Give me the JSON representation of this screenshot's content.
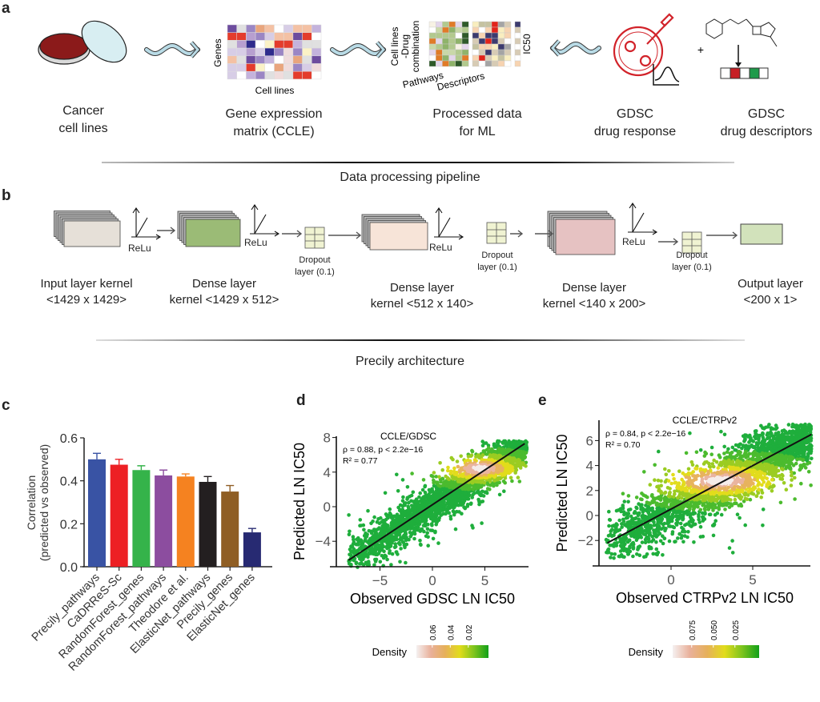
{
  "panels": {
    "a": "a",
    "b": "b",
    "c": "c",
    "d": "d",
    "e": "e"
  },
  "pipeline": {
    "cancer_cells": [
      "Cancer",
      "cell lines"
    ],
    "gene_matrix": [
      "Gene expression",
      "matrix (CCLE)"
    ],
    "gene_matrix_axes": {
      "y": "Genes",
      "x": "Cell lines"
    },
    "processed": [
      "Processed data",
      "for ML"
    ],
    "processed_axes": {
      "y1": "Cell lines",
      "y2": "-Drug",
      "y3": "combination",
      "x1": "Pathways",
      "x2": "Descriptors",
      "ic50": "IC50"
    },
    "drug_response": [
      "GDSC",
      "drug response"
    ],
    "plus": "+",
    "drug_descriptors": [
      "GDSC",
      "drug descriptors"
    ],
    "title": "Data processing pipeline",
    "colors": {
      "arrow": "#b9dbe6",
      "dish": "#8b1a1a",
      "response_icon": "#d2232a",
      "desc_red": "#c62026",
      "desc_green": "#1f9a4a"
    }
  },
  "architecture": {
    "relu": "ReLu",
    "layers": [
      {
        "name": "Input layer kernel",
        "size": "<1429 x 1429>",
        "color": "#e6e0d8"
      },
      {
        "name": "Dense layer",
        "size": "kernel <1429 x 512>",
        "color": "#9bbb76"
      },
      {
        "name": "Dense layer",
        "size": "kernel <512 x 140>",
        "color": "#f7e4d8"
      },
      {
        "name": "Dense layer",
        "size": "kernel <140 x 200>",
        "color": "#e6c2c2"
      },
      {
        "name": "Output layer",
        "size": "<200 x 1>",
        "color": "#d2e2bb"
      }
    ],
    "dropout": [
      "Dropout",
      "layer (0.1)"
    ],
    "dropout_color": "#f0f3d2",
    "title": "Precily architecture"
  },
  "chart_data": [
    {
      "type": "bar",
      "ylabel": [
        "Correlation",
        "(predicted vs observed)"
      ],
      "categories": [
        "Precily_pathways",
        "CaDRReS-Sc",
        "RandomForest_genes",
        "RandomForest_pathways",
        "Theodore et al.",
        "ElasticNet_pathways",
        "Precily_genes",
        "ElasticNet_genes"
      ],
      "values": [
        0.5,
        0.475,
        0.45,
        0.425,
        0.42,
        0.395,
        0.35,
        0.16
      ],
      "errors": [
        0.028,
        0.025,
        0.02,
        0.025,
        0.012,
        0.025,
        0.028,
        0.018
      ],
      "colors": [
        "#3953a4",
        "#ed2024",
        "#35b34a",
        "#8c4d9f",
        "#f58220",
        "#231f20",
        "#8f5e24",
        "#272a72"
      ],
      "ylim": [
        0,
        0.6
      ],
      "yticks": [
        "0.0",
        "0.2",
        "0.4",
        "0.6"
      ]
    },
    {
      "type": "scatter",
      "title": "CCLE/GDSC",
      "xlabel": "Observed GDSC LN IC50",
      "ylabel": "Predicted LN IC50",
      "xlim": [
        -9,
        9
      ],
      "ylim": [
        -7,
        8
      ],
      "xticks": [
        "−5",
        "0",
        "5"
      ],
      "xtick_values": [
        -5,
        0,
        5
      ],
      "yticks": [
        "−4",
        "0",
        "4",
        "8"
      ],
      "ytick_values": [
        -4,
        0,
        4,
        8
      ],
      "annotation": [
        "ρ = 0.88, p < 2.2e−16",
        "R² = 0.77"
      ],
      "fit_line": {
        "x": [
          -8,
          8.8
        ],
        "y": [
          -6.2,
          7.3
        ]
      },
      "cloud": {
        "x_range": [
          -8,
          9
        ],
        "slope": 0.8,
        "intercept": 0.2,
        "dense_center": [
          4.5,
          4.4
        ]
      },
      "colorbar": {
        "label": "Density",
        "ticks": [
          "0.06",
          "0.04",
          "0.02"
        ],
        "colors": [
          "#f5f0f0",
          "#e9b09a",
          "#e6b05a",
          "#e2dc1c",
          "#7ec41e",
          "#12a019"
        ]
      }
    },
    {
      "type": "scatter",
      "title": "CCLE/CTRPv2",
      "xlabel": "Observed CTRPv2 LN IC50",
      "ylabel": "Predicted LN IC50",
      "xlim": [
        -4.5,
        8.8
      ],
      "ylim": [
        -3.5,
        7.5
      ],
      "xticks": [
        "0",
        "5"
      ],
      "xtick_values": [
        0,
        5
      ],
      "yticks": [
        "−2",
        "0",
        "2",
        "4",
        "6"
      ],
      "ytick_values": [
        -2,
        0,
        2,
        4,
        6
      ],
      "annotation": [
        "ρ = 0.84, p < 2.2e−16",
        "R² = 0.70"
      ],
      "fit_line": {
        "x": [
          -3.9,
          8.6
        ],
        "y": [
          -2.2,
          6.5
        ]
      },
      "cloud": {
        "x_range": [
          -4,
          8.6
        ],
        "slope": 0.7,
        "intercept": 0.5,
        "dense_center": [
          3,
          2.8
        ]
      },
      "colorbar": {
        "label": "Density",
        "ticks": [
          "0.075",
          "0.050",
          "0.025"
        ],
        "colors": [
          "#f5f0f0",
          "#e9b09a",
          "#e6b05a",
          "#e2dc1c",
          "#7ec41e",
          "#12a019"
        ]
      }
    }
  ]
}
